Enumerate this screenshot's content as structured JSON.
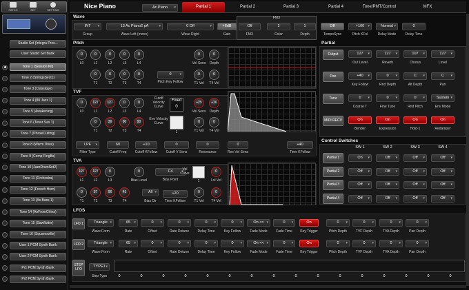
{
  "colors": {
    "accent": "#c21b1b",
    "panel": "#1a1a1a",
    "knob_ring_red": "#c21b1b",
    "button_on": "#d61818"
  },
  "sidebar": {
    "toolbar": {
      "items": [
        {
          "label": "PATCH",
          "icon": "patch-icon"
        },
        {
          "label": "SET",
          "icon": "set-icon"
        },
        {
          "label": "SETTING",
          "icon": "setting-icon"
        }
      ]
    },
    "sets": [
      "Studio Set (Integra Pres...",
      "User Studio Set Bank"
    ],
    "tones": [
      "Tone 1 (Session Kit)",
      "Tone 2 (StringsSect1)",
      "Tone 3 (Classique)",
      "Tone 4 (80 Jazz 1)",
      "Tone 5 (Awakening)",
      "Tone 6 (Tenor Sax 1)",
      "Tone 7 (PhaseCutting)",
      "Tone 8 (Warm Drive)",
      "Tone 9 (Comp FingBs)",
      "Tone 10 (JazzDrumSet2)",
      "Tone 11 (Orchestra)",
      "Tone 12 (French Horn)",
      "Tone 13 (As Bass 1)",
      "Tone 14 (AirFromChina)",
      "Tone 15 (Sawflutter)",
      "Tone 16 (Squaresville)",
      "User 1 PCM Synth Bank",
      "User 2 PCM Synth Bank",
      "Pr1 PCM Synth Bank",
      "Pr2 PCM Synth Bank"
    ]
  },
  "header": {
    "title": "Nice Piano",
    "category": "Ac.Piano",
    "tabs": [
      "Partial 1",
      "Partial 2",
      "Partial 3",
      "Partial 4",
      "Tone/PMT/Control",
      "MFX"
    ]
  },
  "wave": {
    "title": "Wave",
    "fmx_title": "FMX",
    "fields": [
      {
        "value": "INT",
        "label": "Group"
      },
      {
        "value": "13 Ac Piano2 pA",
        "label": "Wave Left (mono)"
      },
      {
        "value": "0 Off",
        "label": "Wave Right"
      },
      {
        "value": "+6dB",
        "label": "Gain"
      },
      {
        "value": "Off",
        "label": "FMX"
      },
      {
        "value": "2",
        "label": "Color"
      },
      {
        "value": "1",
        "label": "Depth"
      },
      {
        "value": "Off",
        "label": "TempoSync"
      },
      {
        "value": "+100",
        "label": "Pitch KFol"
      },
      {
        "value": "Normal",
        "label": "Delay Mode"
      },
      {
        "value": "0",
        "label": "Delay Time"
      }
    ]
  },
  "pitch": {
    "title": "Pitch",
    "levels": {
      "values": [
        "0",
        "0",
        "0",
        "0",
        "0"
      ],
      "labels": [
        "L0",
        "L1",
        "L2",
        "L3",
        "L4"
      ]
    },
    "times": {
      "values": [
        "0",
        "0",
        "0",
        "0"
      ],
      "labels": [
        "T1",
        "T2",
        "T3",
        "T4"
      ]
    },
    "key_follow": {
      "value": "0",
      "label": "Pitch Key Follow"
    },
    "vel_sens": {
      "value": "0",
      "label": "Vel Sens"
    },
    "depth": {
      "value": "0",
      "label": "Depth"
    },
    "t1vel": {
      "value": "0",
      "label": "T1 Vel"
    },
    "t4vel": {
      "value": "0",
      "label": "T4 Vel"
    }
  },
  "tvf": {
    "title": "TVF",
    "levels": {
      "values": [
        "0",
        "127",
        "127",
        "0",
        "0"
      ],
      "labels": [
        "L0",
        "L1",
        "L2",
        "L3",
        "L4"
      ]
    },
    "times": {
      "values": [
        "0",
        "36",
        "90",
        "90"
      ],
      "labels": [
        "T1",
        "T2",
        "T3",
        "T4"
      ]
    },
    "cutoff_curve_label": "Cutoff Velocity Curve",
    "cutoff_curve_value": "Fixed",
    "cutoff_curve_num": "0",
    "env_curve_label": "Env Velocity Curve",
    "env_curve_num": "1",
    "vel_sens": {
      "value": "+25",
      "label": "Vel Sens"
    },
    "depth": {
      "value": "+16",
      "label": "Depth"
    },
    "t1vel": {
      "value": "0",
      "label": "T1 Vel"
    },
    "t4vel": {
      "value": "0",
      "label": "T4 Vel"
    },
    "fields": [
      {
        "value": "LPF",
        "label": "Filter Type"
      },
      {
        "value": "60",
        "label": "Cutoff Freq"
      },
      {
        "value": "+10",
        "label": "Cutoff KFollow"
      },
      {
        "value": "0",
        "label": "Cutoff V Sens"
      },
      {
        "value": "0",
        "label": "Resonance"
      },
      {
        "value": "0",
        "label": "Res Vel Sens"
      },
      {
        "value": "+40",
        "label": "Time KFollow"
      }
    ]
  },
  "tva": {
    "title": "TVA",
    "levels": {
      "values": [
        "127",
        "127",
        "0"
      ],
      "labels": [
        "L1",
        "L2",
        "L3"
      ]
    },
    "times": {
      "values": [
        "0",
        "37",
        "96",
        "43"
      ],
      "labels": [
        "T1",
        "T2",
        "T3",
        "T4"
      ]
    },
    "bias_level": {
      "value": "0",
      "label": "Bias Level"
    },
    "bias_point": {
      "value": "C4",
      "label": "Bias Point"
    },
    "bias_dir": {
      "value": "All",
      "label": "Bias Dir"
    },
    "time_kfollow": {
      "value": "+20",
      "label": "Time KFollow"
    },
    "vel_curve_label": "Vel Curve",
    "vel_curve_num": "1",
    "lvl_vel": {
      "value": "0",
      "label": "Lvl Vel"
    },
    "t1vel": {
      "value": "0",
      "label": "T1 Vel"
    },
    "t4vel": {
      "value": "0",
      "label": "T4 Vel"
    }
  },
  "partial": {
    "title": "Partial",
    "output": {
      "button": "Output",
      "fields": [
        {
          "value": "127",
          "label": "Out Level"
        },
        {
          "value": "127",
          "label": "Reverb"
        },
        {
          "value": "107",
          "label": "Chorus"
        },
        {
          "value": "127",
          "label": "Level"
        }
      ]
    },
    "pan": {
      "button": "Pan",
      "fields": [
        {
          "value": "+40",
          "label": "Key Follow"
        },
        {
          "value": "0",
          "label": "Rnd Depth"
        },
        {
          "value": "C",
          "label": "Alt Depth"
        },
        {
          "value": "C",
          "label": "Pan"
        }
      ]
    },
    "tune": {
      "button": "Tune",
      "fields": [
        {
          "value": "0",
          "label": "Coarse T"
        },
        {
          "value": "0",
          "label": "Fine Tune"
        },
        {
          "value": "0",
          "label": "Rnd Pitch"
        },
        {
          "value": "Sustain",
          "label": "Env Mode"
        }
      ]
    },
    "midi": {
      "button": "MIDI RECV",
      "fields": [
        {
          "value": "On",
          "label": "Bender"
        },
        {
          "value": "On",
          "label": "Expression"
        },
        {
          "value": "On",
          "label": "Hold-1"
        },
        {
          "value": "On",
          "label": "Redamper"
        }
      ]
    }
  },
  "control_switches": {
    "title": "Control Switches",
    "columns": [
      "SW 1",
      "SW 2",
      "SW 3",
      "SW 4"
    ],
    "rows": [
      {
        "label": "Partial 1",
        "values": [
          "On",
          "Off",
          "Off",
          "Off"
        ]
      },
      {
        "label": "Partial 2",
        "values": [
          "Off",
          "Off",
          "Off",
          "Off"
        ]
      },
      {
        "label": "Partial 3",
        "values": [
          "Off",
          "Off",
          "Off",
          "Off"
        ]
      },
      {
        "label": "Partial 4",
        "values": [
          "Off",
          "Off",
          "Off",
          "Off"
        ]
      }
    ]
  },
  "lfos": {
    "title": "LFOS",
    "labels": [
      "Wave Form",
      "Rate",
      "Offset",
      "Rate Detune",
      "Delay Time",
      "Key Follow",
      "Fade Mode",
      "Fade Time",
      "Key Trigger",
      "Pitch Depth",
      "TVF Depth",
      "TVA Depth",
      "Pan Depth"
    ],
    "rows": [
      {
        "name": "LFO 1",
        "values": [
          "Triangle",
          "65",
          "0",
          "0",
          "0",
          "0",
          "On <<",
          "0",
          "On",
          "0",
          "0",
          "0",
          "0"
        ]
      },
      {
        "name": "LFO 2",
        "values": [
          "Triangle",
          "65",
          "0",
          "0",
          "0",
          "0",
          "On <<",
          "0",
          "On",
          "0",
          "0",
          "0",
          "0"
        ]
      }
    ],
    "step": {
      "name": "STEP LFO",
      "type": "TYPE1",
      "label": "Step Type",
      "values": [
        "0",
        "0",
        "0",
        "0",
        "0",
        "0",
        "0",
        "0",
        "0",
        "0",
        "0",
        "0",
        "0",
        "0",
        "0",
        "0"
      ]
    }
  }
}
